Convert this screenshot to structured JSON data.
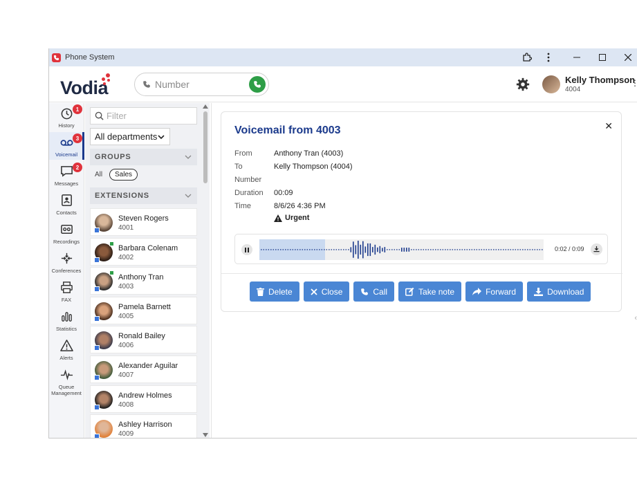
{
  "window": {
    "title": "Phone System"
  },
  "header": {
    "logo": "Vodia",
    "number_placeholder": "Number",
    "user_name": "Kelly Thompson",
    "user_ext": "4004"
  },
  "nav": [
    {
      "label": "History",
      "badge": "1"
    },
    {
      "label": "Voicemail",
      "badge": "3"
    },
    {
      "label": "Messages",
      "badge": "2"
    },
    {
      "label": "Contacts",
      "badge": ""
    },
    {
      "label": "Recordings",
      "badge": ""
    },
    {
      "label": "Conferences",
      "badge": ""
    },
    {
      "label": "FAX",
      "badge": ""
    },
    {
      "label": "Statistics",
      "badge": ""
    },
    {
      "label": "Alerts",
      "badge": ""
    },
    {
      "label": "Queue Management",
      "badge": ""
    }
  ],
  "contacts": {
    "filter_placeholder": "Filter",
    "department": "All departments",
    "groups_header": "GROUPS",
    "group_all": "All",
    "group_sales": "Sales",
    "extensions_header": "EXTENSIONS",
    "extensions": [
      {
        "name": "Steven Rogers",
        "number": "4001"
      },
      {
        "name": "Barbara Colenam",
        "number": "4002"
      },
      {
        "name": "Anthony Tran",
        "number": "4003"
      },
      {
        "name": "Pamela Barnett",
        "number": "4005"
      },
      {
        "name": "Ronald Bailey",
        "number": "4006"
      },
      {
        "name": "Alexander Aguilar",
        "number": "4007"
      },
      {
        "name": "Andrew Holmes",
        "number": "4008"
      },
      {
        "name": "Ashley Harrison",
        "number": "4009"
      }
    ]
  },
  "voicemail": {
    "title": "Voicemail from 4003",
    "labels": {
      "from": "From",
      "to": "To",
      "number": "Number",
      "duration": "Duration",
      "time": "Time"
    },
    "values": {
      "from": "Anthony Tran (4003)",
      "to": "Kelly Thompson (4004)",
      "number": "",
      "duration": "00:09",
      "time": "8/6/26 4:36 PM"
    },
    "urgent": "Urgent",
    "player": {
      "time": "0:02 / 0:09",
      "progress": 0.23
    },
    "actions": {
      "delete": "Delete",
      "close": "Close",
      "call": "Call",
      "take_note": "Take note",
      "forward": "Forward",
      "download": "Download"
    }
  },
  "colors": {
    "brand": "#e0333c",
    "accent": "#1b3a8c",
    "button": "#4a86d4",
    "call": "#2e9e47"
  }
}
